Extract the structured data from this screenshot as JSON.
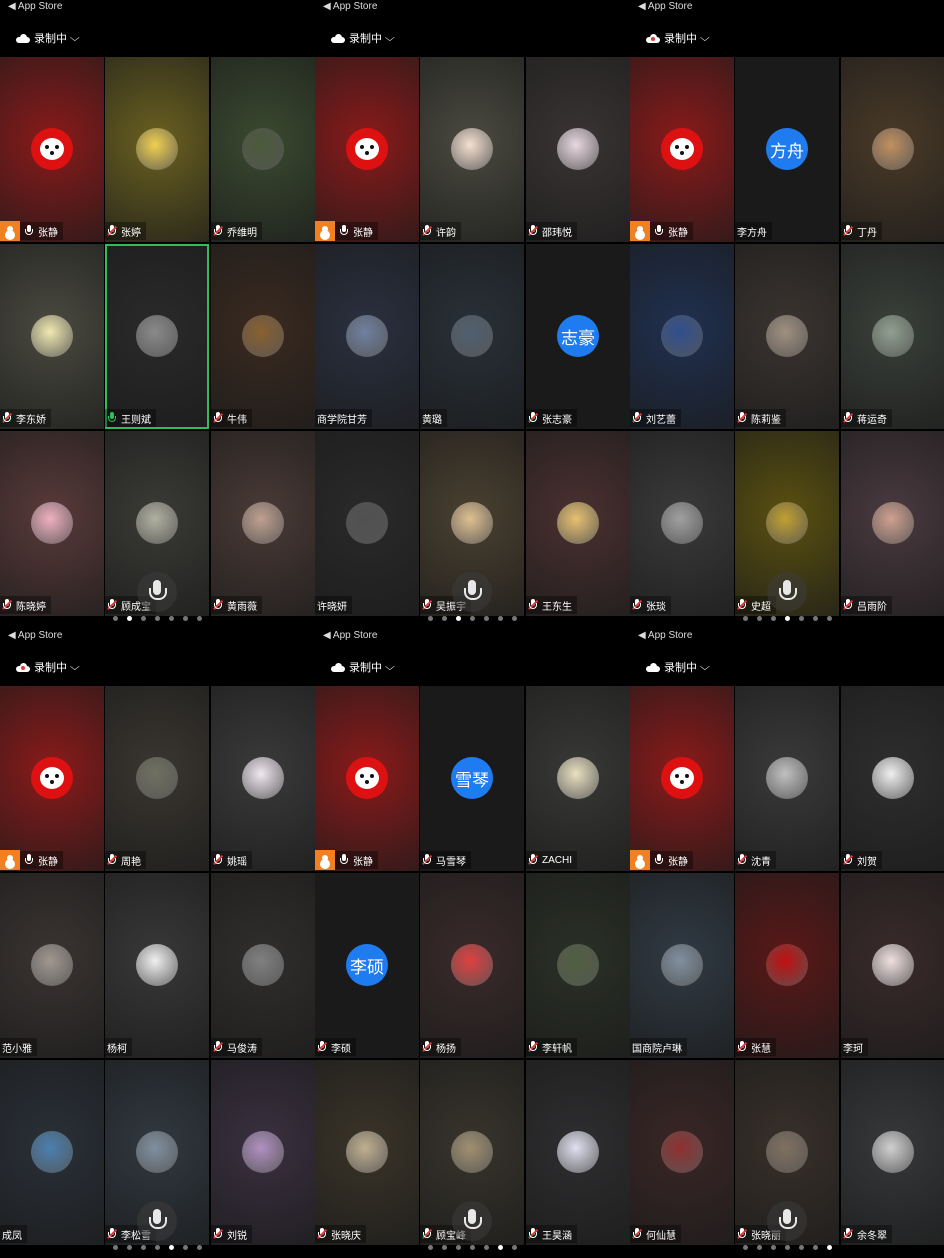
{
  "status_bar": {
    "back_label": "◀ App Store"
  },
  "recording": {
    "label": "录制中"
  },
  "panels": [
    {
      "cloud_red": false,
      "active_page": 1,
      "tiles": [
        {
          "name": "张静",
          "host": true,
          "mic": "on",
          "avatar": "panda",
          "bg": "#8b1a1a"
        },
        {
          "name": "张婷",
          "mic": "muted",
          "avatar": "img",
          "avc": "#f0d050",
          "bg": "#6a6020"
        },
        {
          "name": "乔维明",
          "mic": "muted",
          "avatar": "img",
          "avc": "#4a5a3a",
          "bg": "#3a4a30"
        },
        {
          "name": "李东娇",
          "mic": "muted",
          "avatar": "img",
          "avc": "#f0e8b0",
          "bg": "#4a4a40"
        },
        {
          "name": "王则斌",
          "mic": "green",
          "avatar": "img",
          "avc": "#8a8a8a",
          "bg": "#2a2a2a",
          "active": true
        },
        {
          "name": "牛伟",
          "mic": "muted",
          "avatar": "img",
          "avc": "#8a6030",
          "bg": "#3a2a20"
        },
        {
          "name": "陈晓婷",
          "mic": "muted",
          "avatar": "img",
          "avc": "#f0b0c0",
          "bg": "#5a3a3a"
        },
        {
          "name": "顾成宝",
          "mic": "muted",
          "avatar": "img",
          "avc": "#b0b0a0",
          "bg": "#3a3a36"
        },
        {
          "name": "黄雨薇",
          "mic": "muted",
          "avatar": "img",
          "avc": "#c0a090",
          "bg": "#4a3a36"
        }
      ]
    },
    {
      "cloud_red": false,
      "active_page": 2,
      "tiles": [
        {
          "name": "张静",
          "host": true,
          "mic": "on",
          "avatar": "panda",
          "bg": "#8b1a1a"
        },
        {
          "name": "许韵",
          "mic": "muted",
          "avatar": "img",
          "avc": "#f4e0d0",
          "bg": "#4a4a40"
        },
        {
          "name": "邵玮悦",
          "mic": "muted",
          "avatar": "img",
          "avc": "#e8d8e0",
          "bg": "#3a3434"
        },
        {
          "name": "商学院甘芳",
          "mic": "none",
          "avatar": "img",
          "avc": "#7080a0",
          "bg": "#2a3040"
        },
        {
          "name": "黄璐",
          "mic": "none",
          "avatar": "img",
          "avc": "#506070",
          "bg": "#283038"
        },
        {
          "name": "张志豪",
          "mic": "muted",
          "avatar": "text",
          "text": "志豪",
          "bg": "#1a1a1a"
        },
        {
          "name": "许晓妍",
          "mic": "none",
          "avatar": "img",
          "avc": "#505050",
          "bg": "#2a2a2a"
        },
        {
          "name": "吴振宇",
          "mic": "muted",
          "avatar": "img",
          "avc": "#e0c090",
          "bg": "#4a4030"
        },
        {
          "name": "王东生",
          "mic": "muted",
          "avatar": "img",
          "avc": "#e8c070",
          "bg": "#4a3030"
        }
      ]
    },
    {
      "cloud_red": true,
      "active_page": 3,
      "tiles": [
        {
          "name": "张静",
          "host": true,
          "mic": "on",
          "avatar": "panda",
          "bg": "#8b1a1a"
        },
        {
          "name": "李方舟",
          "mic": "none",
          "avatar": "text",
          "text": "方舟",
          "bg": "#1a1a1a"
        },
        {
          "name": "丁丹",
          "mic": "muted",
          "avatar": "img",
          "avc": "#c09060",
          "bg": "#4a3a28"
        },
        {
          "name": "刘艺蕾",
          "mic": "muted",
          "avatar": "img",
          "avc": "#305090",
          "bg": "#203050"
        },
        {
          "name": "陈莉鉴",
          "mic": "muted",
          "avatar": "img",
          "avc": "#a09080",
          "bg": "#3a3430"
        },
        {
          "name": "蒋运奇",
          "mic": "muted",
          "avatar": "img",
          "avc": "#90a090",
          "bg": "#3a403a"
        },
        {
          "name": "张琰",
          "mic": "muted",
          "avatar": "img",
          "avc": "#a0a0a0",
          "bg": "#3a3a3a"
        },
        {
          "name": "史超",
          "mic": "muted",
          "avatar": "img",
          "avc": "#c0a030",
          "bg": "#5a5010"
        },
        {
          "name": "吕雨阶",
          "mic": "muted",
          "avatar": "img",
          "avc": "#d0a090",
          "bg": "#4a3a40"
        }
      ]
    },
    {
      "cloud_red": true,
      "active_page": 4,
      "tiles": [
        {
          "name": "张静",
          "host": true,
          "mic": "on",
          "avatar": "panda",
          "bg": "#8b1a1a"
        },
        {
          "name": "周艳",
          "mic": "muted",
          "avatar": "img",
          "avc": "#707060",
          "bg": "#3a3630"
        },
        {
          "name": "姚瑶",
          "mic": "muted",
          "avatar": "img",
          "avc": "#f0e8f0",
          "bg": "#3a3a3a"
        },
        {
          "name": "范小雅",
          "mic": "none",
          "avatar": "img",
          "avc": "#a09890",
          "bg": "#3a3432"
        },
        {
          "name": "杨柯",
          "mic": "none",
          "avatar": "img",
          "avc": "#f0f0f0",
          "bg": "#383838"
        },
        {
          "name": "马俊涛",
          "mic": "muted",
          "avatar": "img",
          "avc": "#808080",
          "bg": "#302e2c"
        },
        {
          "name": "成凤",
          "mic": "none",
          "avatar": "img",
          "avc": "#4a80b0",
          "bg": "#2a3038"
        },
        {
          "name": "李松雪",
          "mic": "muted",
          "avatar": "img",
          "avc": "#8090a0",
          "bg": "#303840"
        },
        {
          "name": "刘锐",
          "mic": "muted",
          "avatar": "img",
          "avc": "#b090c0",
          "bg": "#3a3040"
        }
      ]
    },
    {
      "cloud_red": false,
      "active_page": 5,
      "tiles": [
        {
          "name": "张静",
          "host": true,
          "mic": "on",
          "avatar": "panda",
          "bg": "#8b1a1a"
        },
        {
          "name": "马雪琴",
          "mic": "muted",
          "avatar": "text",
          "text": "雪琴",
          "bg": "#1a1a1a"
        },
        {
          "name": "ZACHI",
          "mic": "muted",
          "avatar": "img",
          "avc": "#e8e0c0",
          "bg": "#383836"
        },
        {
          "name": "李硕",
          "mic": "muted",
          "avatar": "text",
          "text": "李硕",
          "bg": "#1a1a1a"
        },
        {
          "name": "杨扬",
          "mic": "muted",
          "avatar": "img",
          "avc": "#e04040",
          "bg": "#3a2a2a"
        },
        {
          "name": "李轩帆",
          "mic": "muted",
          "avatar": "img",
          "avc": "#506040",
          "bg": "#2a3026"
        },
        {
          "name": "张晓庆",
          "mic": "muted",
          "avatar": "img",
          "avc": "#c0b090",
          "bg": "#3a3428"
        },
        {
          "name": "顾宝峰",
          "mic": "muted",
          "avatar": "img",
          "avc": "#a09070",
          "bg": "#38342c"
        },
        {
          "name": "王昊涵",
          "mic": "muted",
          "avatar": "img",
          "avc": "#e0e0f0",
          "bg": "#2e2e30"
        }
      ]
    },
    {
      "cloud_red": false,
      "active_page": 6,
      "tiles": [
        {
          "name": "张静",
          "host": true,
          "mic": "on",
          "avatar": "panda",
          "bg": "#8b1a1a"
        },
        {
          "name": "沈青",
          "mic": "muted",
          "avatar": "img",
          "avc": "#c0c0c0",
          "bg": "#3a3a3a"
        },
        {
          "name": "刘贺",
          "mic": "muted",
          "avatar": "img",
          "avc": "#f0f0f0",
          "bg": "#2e2e2e"
        },
        {
          "name": "国商院卢琳",
          "mic": "none",
          "avatar": "img",
          "avc": "#8090a0",
          "bg": "#303a44"
        },
        {
          "name": "张慧",
          "mic": "muted",
          "avatar": "img",
          "avc": "#c01010",
          "bg": "#5a1818"
        },
        {
          "name": "李珂",
          "mic": "none",
          "avatar": "img",
          "avc": "#f0e0e0",
          "bg": "#3a2a2a"
        },
        {
          "name": "何仙慧",
          "mic": "muted",
          "avatar": "img",
          "avc": "#903030",
          "bg": "#3a2626"
        },
        {
          "name": "张晓丽",
          "mic": "muted",
          "avatar": "img",
          "avc": "#807060",
          "bg": "#38302a"
        },
        {
          "name": "余冬翠",
          "mic": "muted",
          "avatar": "img",
          "avc": "#d0d0d0",
          "bg": "#36383a"
        }
      ]
    }
  ],
  "page_count": 7
}
